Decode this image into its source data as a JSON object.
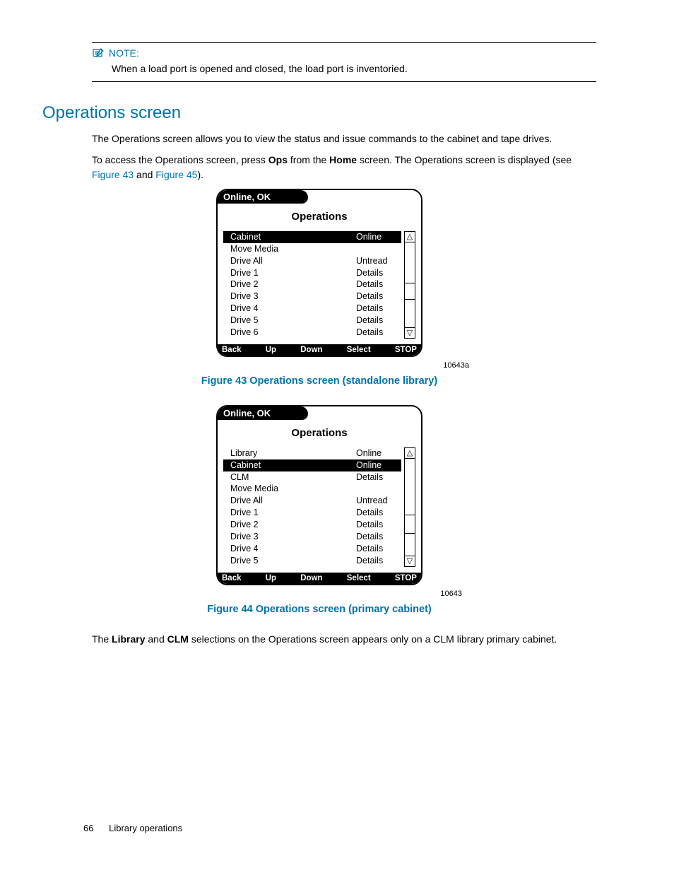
{
  "note": {
    "label": "NOTE:",
    "text": "When a load port is opened and closed, the load port is inventoried."
  },
  "section_title": "Operations screen",
  "para1": "The Operations screen allows you to view the status and issue commands to the cabinet and tape drives.",
  "para2a": "To access the Operations screen, press ",
  "para2b": "Ops",
  "para2c": " from the ",
  "para2d": "Home",
  "para2e": " screen. The Operations screen is displayed (see ",
  "para2f": "Figure 43",
  "para2g": " and ",
  "para2h": "Figure 45",
  "para2i": ").",
  "fig43": {
    "status": "Online, OK",
    "title": "Operations",
    "rows": [
      {
        "l": "Cabinet",
        "r": "Online",
        "sel": true
      },
      {
        "l": "Move Media",
        "r": ""
      },
      {
        "l": "Drive All",
        "r": "Untread"
      },
      {
        "l": "Drive 1",
        "r": "Details"
      },
      {
        "l": "Drive 2",
        "r": "Details"
      },
      {
        "l": "Drive 3",
        "r": "Details"
      },
      {
        "l": "Drive 4",
        "r": "Details"
      },
      {
        "l": "Drive 5",
        "r": "Details"
      },
      {
        "l": "Drive 6",
        "r": "Details"
      }
    ],
    "buttons": [
      "Back",
      "Up",
      "Down",
      "Select",
      "STOP"
    ],
    "id": "10643a",
    "caption": "Figure 43 Operations screen (standalone library)"
  },
  "fig44": {
    "status": "Online, OK",
    "title": "Operations",
    "rows": [
      {
        "l": "Library",
        "r": "Online"
      },
      {
        "l": "Cabinet",
        "r": "Online",
        "sel": true
      },
      {
        "l": "CLM",
        "r": "Details"
      },
      {
        "l": "Move Media",
        "r": ""
      },
      {
        "l": "Drive All",
        "r": "Untread"
      },
      {
        "l": "Drive 1",
        "r": "Details"
      },
      {
        "l": "Drive 2",
        "r": "Details"
      },
      {
        "l": "Drive 3",
        "r": "Details"
      },
      {
        "l": "Drive 4",
        "r": "Details"
      },
      {
        "l": "Drive 5",
        "r": "Details"
      }
    ],
    "buttons": [
      "Back",
      "Up",
      "Down",
      "Select",
      "STOP"
    ],
    "id": "10643",
    "caption": "Figure 44 Operations screen (primary cabinet)"
  },
  "para3a": "The ",
  "para3b": "Library",
  "para3c": " and ",
  "para3d": "CLM",
  "para3e": " selections on the Operations screen appears only on a CLM library primary cabinet.",
  "footer": {
    "page": "66",
    "chapter": "Library operations"
  }
}
